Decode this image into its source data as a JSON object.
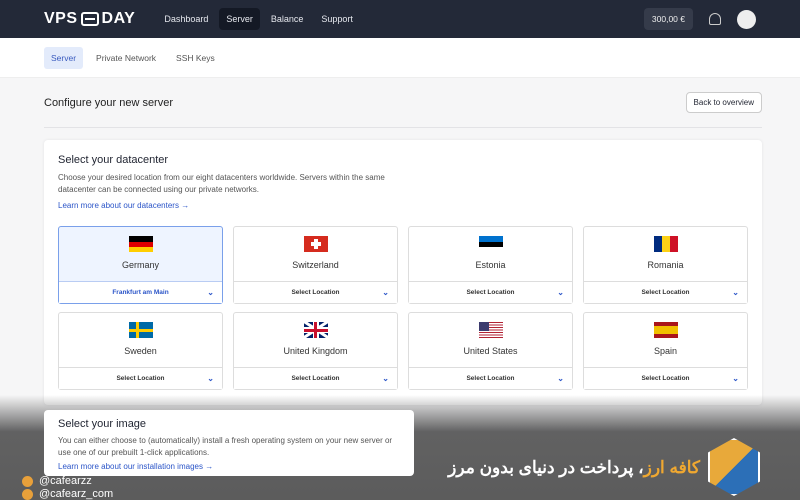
{
  "header": {
    "logo": "VPS2DAY",
    "nav": [
      "Dashboard",
      "Server",
      "Balance",
      "Support"
    ],
    "active_nav": "Server",
    "balance": "300,00 €"
  },
  "subnav": {
    "tabs": [
      "Server",
      "Private Network",
      "SSH Keys"
    ],
    "active": "Server"
  },
  "page": {
    "title": "Configure your new server",
    "back_button": "Back to overview"
  },
  "datacenter": {
    "title": "Select your datacenter",
    "description": "Choose your desired location from our eight datacenters worldwide. Servers within the same datacenter can be connected using our private networks.",
    "link": "Learn more about our datacenters →",
    "items": [
      {
        "name": "Germany",
        "location": "Frankfurt am Main",
        "selected": true,
        "flag": [
          "#000000",
          "#dd0000",
          "#ffce00"
        ],
        "dir": "h"
      },
      {
        "name": "Switzerland",
        "location": "Select Location",
        "flag": "ch"
      },
      {
        "name": "Estonia",
        "location": "Select Location",
        "flag": [
          "#0072ce",
          "#000000",
          "#ffffff"
        ],
        "dir": "h"
      },
      {
        "name": "Romania",
        "location": "Select Location",
        "flag": [
          "#002b7f",
          "#fcd116",
          "#ce1126"
        ],
        "dir": "v"
      },
      {
        "name": "Sweden",
        "location": "Select Location",
        "flag": "se"
      },
      {
        "name": "United Kingdom",
        "location": "Select Location",
        "flag": "gb"
      },
      {
        "name": "United States",
        "location": "Select Location",
        "flag": "us"
      },
      {
        "name": "Spain",
        "location": "Select Location",
        "flag": [
          "#aa151b",
          "#f1bf00",
          "#f1bf00",
          "#aa151b"
        ],
        "dir": "h"
      }
    ]
  },
  "image": {
    "title": "Select your image",
    "description": "You can either choose to (automatically) install a fresh operating system on your new server or use one of our prebuilt 1-click applications.",
    "link": "Learn more about our installation images →"
  },
  "watermark": {
    "telegram": "@cafearzz",
    "instagram": "@cafearz_com",
    "brand": "کافه ارز",
    "slogan": "، پرداخت در دنیای بدون مرز"
  }
}
